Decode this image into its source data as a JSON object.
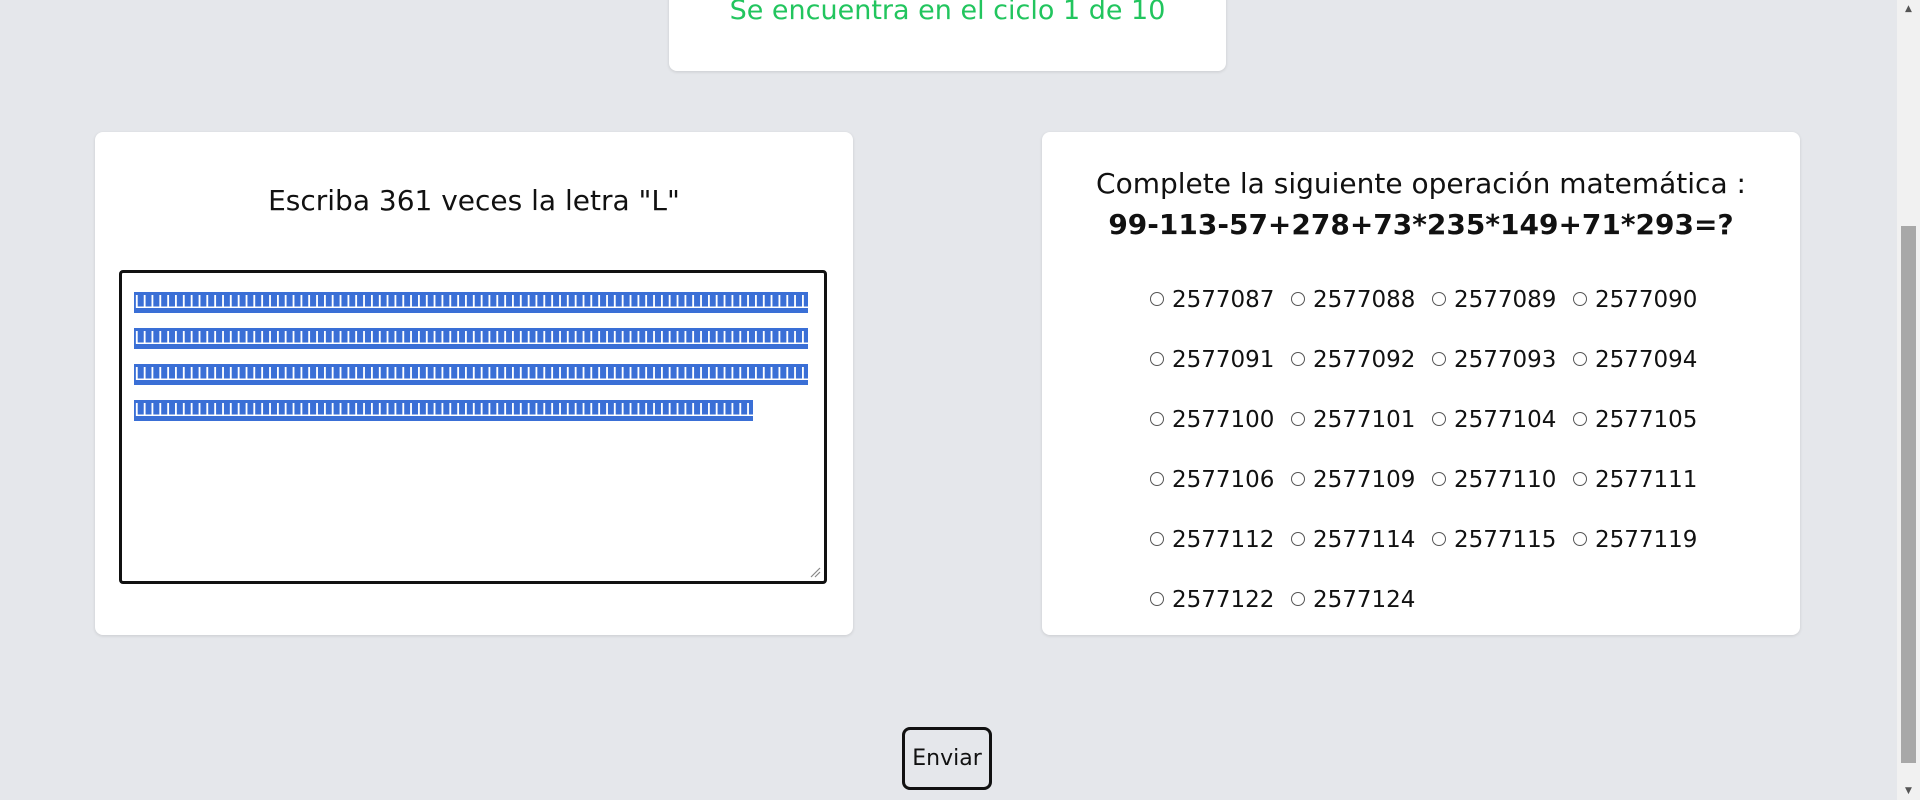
{
  "header": {
    "cycle_text": "Se encuentra en el ciclo 1 de 10"
  },
  "left_card": {
    "title": "Escriba 361 veces la letra \"L\"",
    "textarea_value": "LLLLLLLLLLLLLLLLLLLLLLLLLLLLLLLLLLLLLLLLLLLLLLLLLLLLLLLLLLLLLLLLLLLLLLLLLLLLLLLLLLLLLLLLLLLLLLLLLLLLLLLLLLLLLLLLLLLLLLLLLLLLLLLLLLLLLLLLLLLLLLLLLLLLLLLLLLLLLLLLLLLLLLLLLLLLLLLLLLLLLLLLLLLLLLLLLLLLLLLLLLLLLLLLLLLLLLLLLLLLLLLLLLLLLLLLLLLLLLLLLLLLLLLLLLLLLLLLLLLLLLLLLLLLLLLLLLLLLLLLLLLLLLLLLLLLLLLLLLLLLLLLLLLLLLLLLLLLLLLLLLLLLLLLLLLLLLLLL"
  },
  "right_card": {
    "title": "Complete la siguiente operación matemática :",
    "expression": "99-113-57+278+73*235*149+71*293=?",
    "options": [
      "2577087",
      "2577088",
      "2577089",
      "2577090",
      "2577091",
      "2577092",
      "2577093",
      "2577094",
      "2577100",
      "2577101",
      "2577104",
      "2577105",
      "2577106",
      "2577109",
      "2577110",
      "2577111",
      "2577112",
      "2577114",
      "2577115",
      "2577119",
      "2577122",
      "2577124"
    ]
  },
  "submit": {
    "label": "Enviar"
  },
  "icons": {
    "scroll_up": "up-arrow-icon",
    "scroll_down": "down-arrow-icon",
    "resize": "resize-grip-icon"
  }
}
